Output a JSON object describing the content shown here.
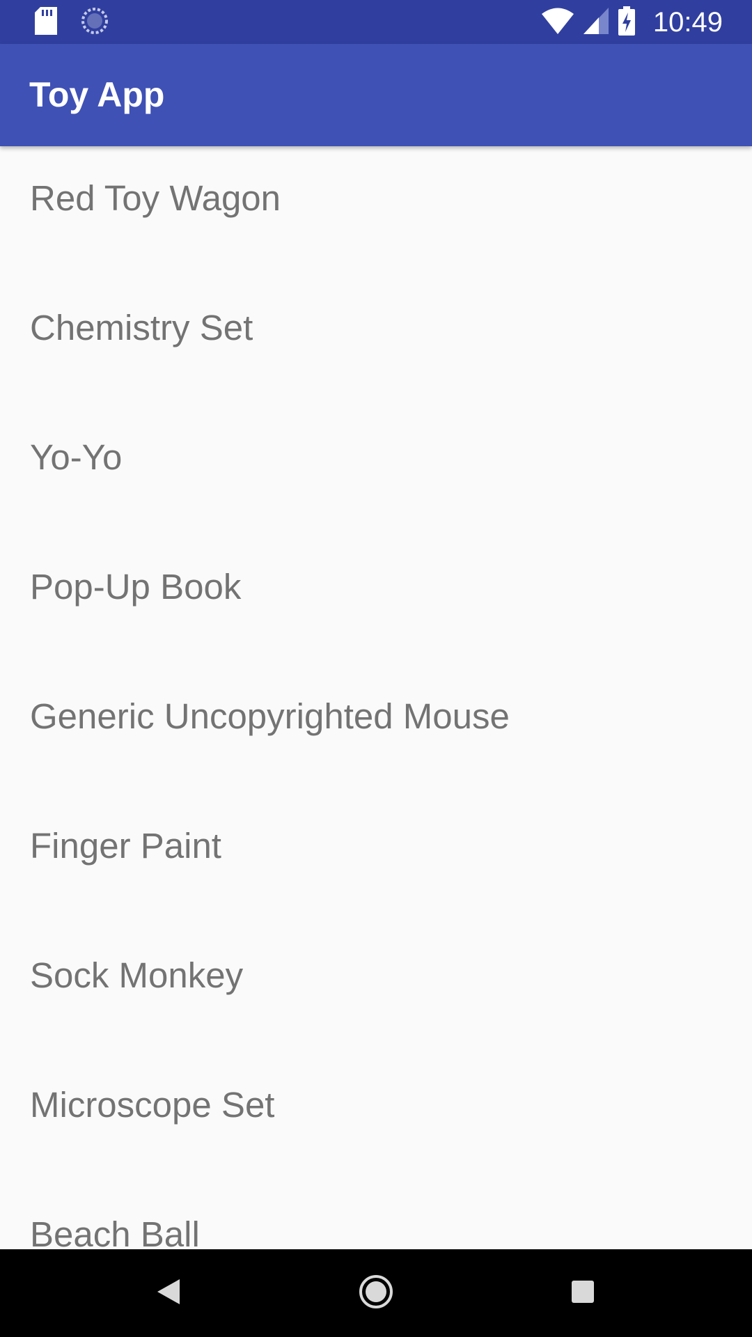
{
  "status_bar": {
    "time": "10:49",
    "icons": [
      "sd-card-icon",
      "sync-icon",
      "wifi-icon",
      "cell-signal-icon",
      "battery-charging-icon"
    ],
    "background": "#303f9f"
  },
  "app_bar": {
    "title": "Toy App",
    "background": "#3f51b5"
  },
  "toy_list": {
    "items": [
      "Red Toy Wagon",
      "Chemistry Set",
      "Yo-Yo",
      "Pop-Up Book",
      "Generic Uncopyrighted Mouse",
      "Finger Paint",
      "Sock Monkey",
      "Microscope Set",
      "Beach Ball"
    ],
    "text_color": "#737373"
  },
  "nav_bar": {
    "buttons": [
      "back-icon",
      "home-icon",
      "recents-icon"
    ],
    "background": "#000000"
  }
}
